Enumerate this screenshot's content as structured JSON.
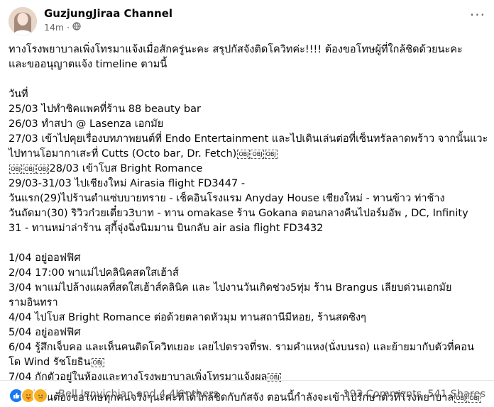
{
  "post": {
    "author": "GuzjungJiraa Channel",
    "time": "14m",
    "dot": "·",
    "privacy_icon": "globe-icon",
    "more_icon": "more-options-icon",
    "more_label": "···"
  },
  "obj_label": "OBJ",
  "content": {
    "intro": [
      "ทางโรงพยาบาลเพิ่งโทรมาแจ้งเมื่อสักครู่นะคะ สรุปกัสจังติดโควิทค่ะ!!!! ต้องขอโทษผู้ที่ใกล้ชิดด้วยนะคะ",
      "และขออนุญาตแจ้ง timeline ตามนี้"
    ],
    "day_header": "วันที่",
    "march": [
      "25/03 ไปทำชิคแพคที่ร้าน 88 beauty bar",
      "26/03 ทำสปา @ Lasenza เอกมัย",
      "27/03 เข้าไปคุยเรื่องบทภาพยนต์ที่ Endo Entertainment และไปเดินเล่นต่อที่เซ็นทรัลลาดพร้าว จากนั้นแวะ",
      "ไปทานโอมากาเสะที่ Cutts (Octo bar, Dr. Fetch)",
      "28/03 เข้าโบส Bright Romance",
      "29/03-31/03 ไปเชียงใหม่ Airasia flight FD3447 -",
      "วันแรก(29)ไปร้านตำแซ่บบายทราย - เช็คอินโรงแรม Anyday House เชียงใหม่ - ทานข้าว ท่าช้าง",
      "วันถัดมา(30) ริวิวก๋วยเตี๋ยว3บาท - ทาน omakase ร้าน Gokana ตอนกลางคืนไปอร์มอัพ , DC, Infinity",
      "31 - ทานหม่าล่าร้าน สุกี้จุ่งฉิ่งนิมมาน บินกลับ air asia flight FD3432"
    ],
    "april": [
      "1/04 อยู่ออฟฟิศ",
      "2/04 17:00 พาแม่ไปคลินิคสดใสเฮ้าส์",
      "3/04 พาแม่ไปล้างแผลที่สดใสเฮ้าส์คลินิค และ ไปงานวันเกิดช่วง5ทุ่ม ร้าน Brangus เลียบด่วนเอกมัย",
      "รามอินทรา",
      "4/04 ไปโบส Bright Romance ต่อด้วยตลาดหัวมุม ทานสถานีมีหอย, ร้านสดซิงๆ",
      "5/04 อยู่ออฟฟิศ",
      "6/04 รู้สึกเจ็บคอ และเห็นคนติดโควิทเยอะ เลยไปตรวจที่รพ. รามคำแหง(นั่งบนรถ) และย้ายมากับตัวที่คอน",
      "โด Wind รัชโยธิน",
      "7/04 กักตัวอยู่ในห้องและทางโรงพยาบาลเพิ่งโทรมาแจ้งผล"
    ],
    "closing": "ทั้งนี้ทั้งนั้นต้องขอโทษทุกคนจริงๆนะคะที่ได้ใกล้ชิดกับกัสจัง ตอนนี้กำลังจะเข้าไปรักษาตัวที่โรงพยาบาล"
  },
  "footer": {
    "reaction_icons": [
      "like-icon",
      "care-icon",
      "sad-icon"
    ],
    "reacted_by": "Bell Janvichian and 4.4K others",
    "comments": "193 Comments",
    "shares": "541 Shares"
  }
}
